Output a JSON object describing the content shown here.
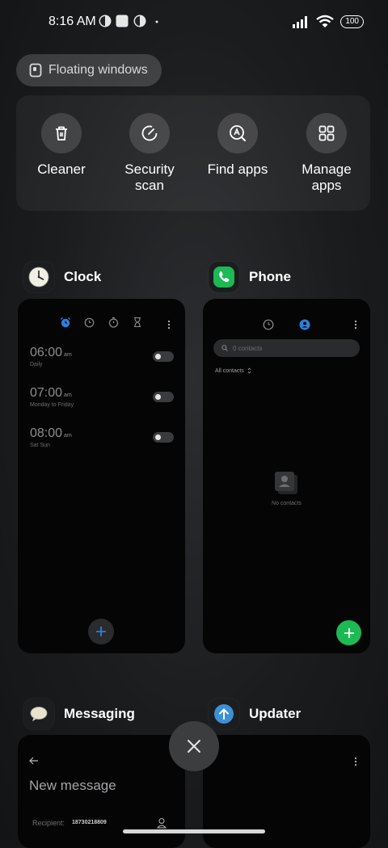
{
  "status_bar": {
    "time": "8:16 AM",
    "battery": "100"
  },
  "floating_windows": {
    "label": "Floating windows"
  },
  "quick_actions": [
    {
      "label": "Cleaner",
      "icon": "trash-icon"
    },
    {
      "label": "Security scan",
      "icon": "security-scan-icon"
    },
    {
      "label": "Find apps",
      "icon": "find-apps-icon"
    },
    {
      "label": "Manage apps",
      "icon": "grid-icon"
    }
  ],
  "apps": {
    "clock": {
      "name": "Clock",
      "alarms": [
        {
          "time": "06:00",
          "ampm": "am",
          "repeat": "Daily",
          "enabled": false
        },
        {
          "time": "07:00",
          "ampm": "am",
          "repeat": "Monday to Friday",
          "enabled": false
        },
        {
          "time": "08:00",
          "ampm": "am",
          "repeat": "Sat Sun",
          "enabled": false
        }
      ]
    },
    "phone": {
      "name": "Phone",
      "search_placeholder": "0 contacts",
      "filter_label": "All contacts",
      "empty_label": "No contacts"
    },
    "messaging": {
      "name": "Messaging",
      "title": "New message",
      "recipient_label": "Recipient:",
      "recipient_value": "18730218809"
    },
    "updater": {
      "name": "Updater"
    }
  },
  "colors": {
    "accent_blue": "#2d7fe0",
    "phone_green": "#1db954",
    "updater_blue": "#3d8fd6"
  }
}
